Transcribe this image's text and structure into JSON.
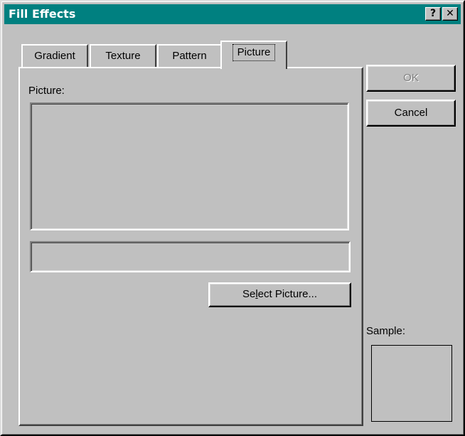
{
  "window": {
    "title": "Fill Effects",
    "help_label": "?",
    "close_label": "✕"
  },
  "tabs": [
    {
      "label": "Gradient",
      "active": false
    },
    {
      "label": "Texture",
      "active": false
    },
    {
      "label": "Pattern",
      "active": false
    },
    {
      "label": "Picture",
      "active": true
    }
  ],
  "picture_panel": {
    "picture_label": "Picture:",
    "select_button": {
      "before": "Se",
      "mnemonic": "l",
      "after": "ect Picture..."
    }
  },
  "buttons": {
    "ok_label": "OK",
    "cancel_label": "Cancel"
  },
  "sample_label": "Sample:",
  "colors": {
    "face": "#c0c0c0",
    "titlebar": "#008080"
  }
}
